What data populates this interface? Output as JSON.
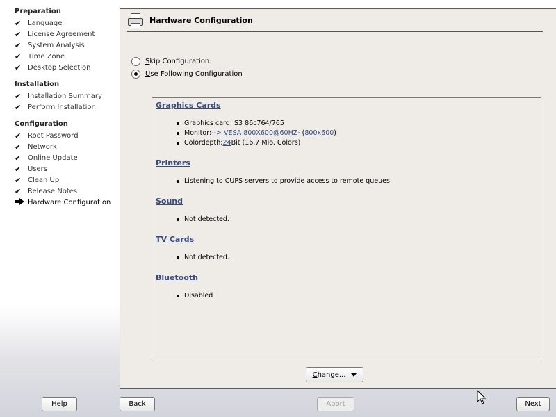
{
  "sidebar": {
    "groups": [
      {
        "heading": "Preparation",
        "items": [
          "Language",
          "License Agreement",
          "System Analysis",
          "Time Zone",
          "Desktop Selection"
        ]
      },
      {
        "heading": "Installation",
        "items": [
          "Installation Summary",
          "Perform Installation"
        ]
      },
      {
        "heading": "Configuration",
        "items": [
          "Root Password",
          "Network",
          "Online Update",
          "Users",
          "Clean Up",
          "Release Notes",
          "Hardware Configuration"
        ]
      }
    ],
    "check_glyph": "✔"
  },
  "main": {
    "title": "Hardware Configuration",
    "radio_skip": {
      "accel": "S",
      "rest": "kip Configuration",
      "checked": false
    },
    "radio_use": {
      "accel": "U",
      "rest": "se Following Configuration",
      "checked": true
    },
    "sections": {
      "graphics": {
        "heading": "Graphics Cards",
        "card": "Graphics card: S3 86c764/765",
        "monitor_prefix": "Monitor: ",
        "monitor_link": "--> VESA 800X600@60HZ",
        "monitor_mid": " - (",
        "monitor_res_link": "800x600",
        "monitor_suffix": ")",
        "depth_prefix": "Colordepth: ",
        "depth_link": "24",
        "depth_suffix": " Bit (16.7 Mio. Colors)"
      },
      "printers": {
        "heading": "Printers",
        "item": "Listening to CUPS servers to provide access to remote queues"
      },
      "sound": {
        "heading": "Sound",
        "item": "Not detected."
      },
      "tv": {
        "heading": "TV Cards",
        "item": "Not detected."
      },
      "bluetooth": {
        "heading": "Bluetooth",
        "item": "Disabled"
      }
    },
    "change_button": {
      "accel": "C",
      "rest": "hange..."
    }
  },
  "footer": {
    "help": "Help",
    "back": {
      "accel": "B",
      "rest": "ack"
    },
    "abort": "Abort",
    "next": {
      "accel": "N",
      "rest": "ext"
    }
  },
  "colors": {
    "link": "#3a4a7a",
    "panel": "#efebe7"
  }
}
